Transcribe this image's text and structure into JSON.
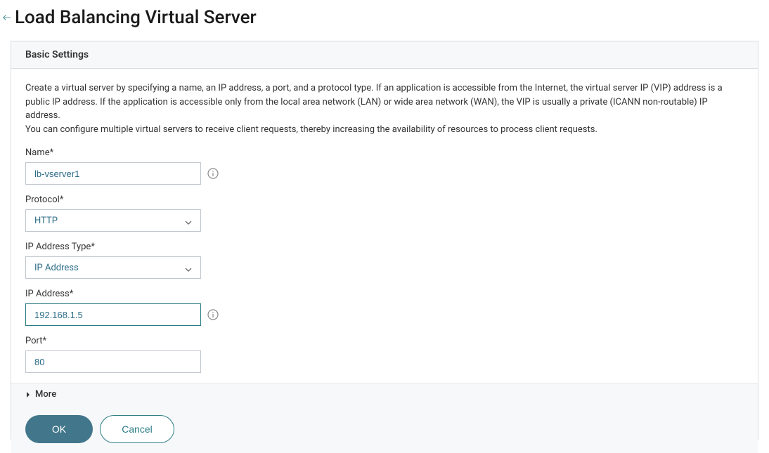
{
  "page": {
    "title": "Load Balancing Virtual Server"
  },
  "panel": {
    "header": "Basic Settings",
    "description_line1": "Create a virtual server by specifying a name, an IP address, a port, and a protocol type. If an application is accessible from the Internet, the virtual server IP (VIP) address is a public IP address. If the application is accessible only from the local area network (LAN) or wide area network (WAN), the VIP is usually a private (ICANN non-routable) IP address.",
    "description_line2": "You can configure multiple virtual servers to receive client requests, thereby increasing the availability of resources to process client requests."
  },
  "form": {
    "name": {
      "label": "Name*",
      "value": "lb-vserver1"
    },
    "protocol": {
      "label": "Protocol*",
      "value": "HTTP"
    },
    "ip_address_type": {
      "label": "IP Address Type*",
      "value": "IP Address"
    },
    "ip_address": {
      "label": "IP Address*",
      "value": "192.168.1.5"
    },
    "port": {
      "label": "Port*",
      "value": "80"
    }
  },
  "more": {
    "label": "More"
  },
  "buttons": {
    "ok": "OK",
    "cancel": "Cancel"
  }
}
